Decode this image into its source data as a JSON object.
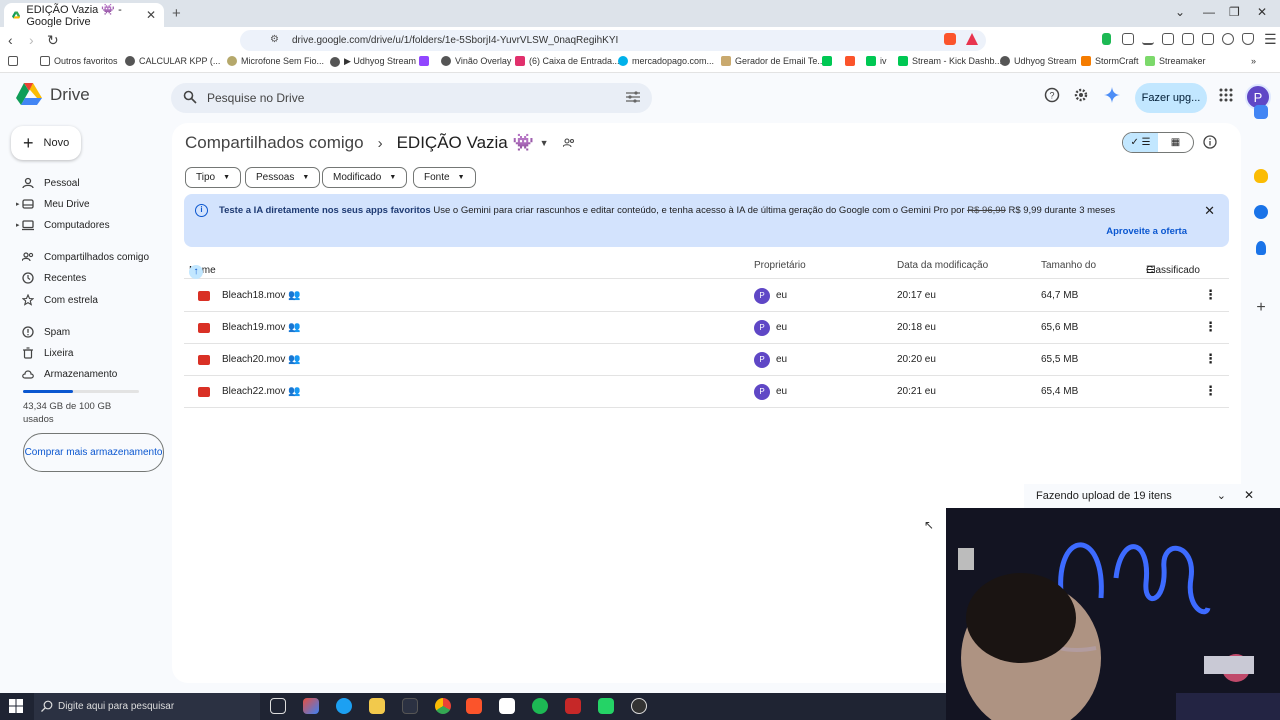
{
  "browser": {
    "tab_title": "EDIÇÃO Vazia 👾 - Google Drive",
    "url": "drive.google.com/drive/u/1/folders/1e-5SborjI4-YuvrVLSW_0naqRegihKYI",
    "bookmarks": [
      {
        "label": "Outros favoritos"
      },
      {
        "label": "CALCULAR KPP (..."
      },
      {
        "label": "Microfone Sem Fio..."
      },
      {
        "label": "▶ Udhyog Stream"
      },
      {
        "label": "Vinão Overlay"
      },
      {
        "label": "(6) Caixa de Entrada..."
      },
      {
        "label": "mercadopago.com..."
      },
      {
        "label": "Gerador de Email Te..."
      },
      {
        "label": "iv"
      },
      {
        "label": "Stream - Kick Dashb..."
      },
      {
        "label": "Udhyog Stream"
      },
      {
        "label": "StormCraft"
      },
      {
        "label": "Streamaker"
      }
    ]
  },
  "drive": {
    "app_name": "Drive",
    "search_placeholder": "Pesquise no Drive",
    "upgrade_label": "Fazer upg...",
    "avatar_letter": "P",
    "new_label": "Novo",
    "nav": [
      {
        "label": "Pessoal"
      },
      {
        "label": "Meu Drive"
      },
      {
        "label": "Computadores"
      },
      {
        "label": "Compartilhados comigo"
      },
      {
        "label": "Recentes"
      },
      {
        "label": "Com estrela"
      },
      {
        "label": "Spam"
      },
      {
        "label": "Lixeira"
      },
      {
        "label": "Armazenamento"
      }
    ],
    "storage": {
      "text": "43,34 GB de 100 GB usados",
      "used_fraction": 0.4334
    },
    "buy_storage_label": "Comprar mais armazenamento"
  },
  "main": {
    "breadcrumb_parent": "Compartilhados comigo",
    "folder_title": "EDIÇÃO Vazia 👾",
    "filters": [
      "Tipo",
      "Pessoas",
      "Modificado",
      "Fonte"
    ],
    "banner": {
      "bold": "Teste a IA diretamente nos seus apps favoritos",
      "text": "Use o Gemini para criar rascunhos e editar conteúdo, e tenha acesso à IA de última geração do Google com o Gemini Pro por",
      "old_price": "R$ 96,99",
      "new_price": "R$ 9,99 durante 3 meses",
      "cta": "Aproveite a oferta"
    },
    "columns": {
      "name": "Nome",
      "owner": "Proprietário",
      "modified": "Data da modificação",
      "size": "Tamanho do",
      "sort": "Classificado"
    },
    "files": [
      {
        "name": "Bleach18.mov",
        "owner": "eu",
        "modified": "20:17 eu",
        "size": "64,7 MB"
      },
      {
        "name": "Bleach19.mov",
        "owner": "eu",
        "modified": "20:18 eu",
        "size": "65,6 MB"
      },
      {
        "name": "Bleach20.mov",
        "owner": "eu",
        "modified": "20:20 eu",
        "size": "65,5 MB"
      },
      {
        "name": "Bleach22.mov",
        "owner": "eu",
        "modified": "20:21 eu",
        "size": "65,4 MB"
      }
    ]
  },
  "upload": {
    "status": "Fazendo upload de 19 itens"
  },
  "taskbar": {
    "search_placeholder": "Digite aqui para pesquisar"
  }
}
